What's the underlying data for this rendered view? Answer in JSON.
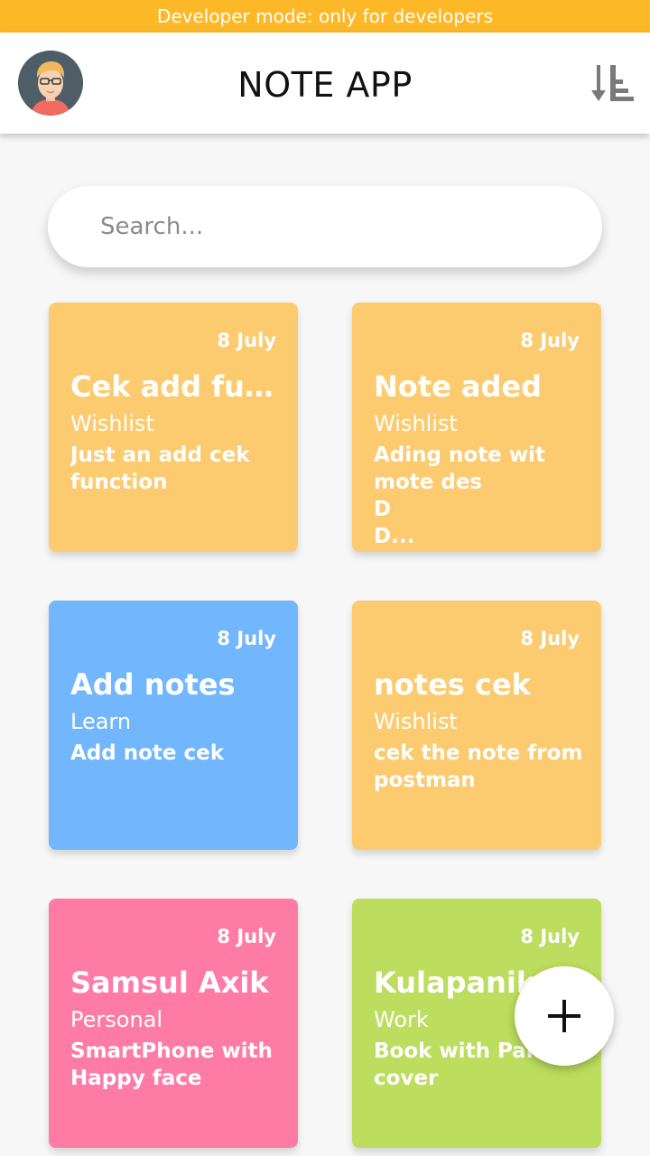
{
  "status_banner": "Developer mode: only for developers",
  "app_bar": {
    "title": "NOTE APP",
    "avatar_icon": "avatar-icon",
    "sort_icon": "sort-descending-icon"
  },
  "search": {
    "placeholder": "Search..."
  },
  "notes": [
    {
      "date": "8 July",
      "title": "Cek add fun...",
      "category": "Wishlist",
      "description": "Just an add cek\nfunction",
      "color": "#fccb70"
    },
    {
      "date": "8 July",
      "title": "Note aded",
      "category": "Wishlist",
      "description": "Ading note wit\nmote des\nD\nD...",
      "color": "#fccb70"
    },
    {
      "date": "8 July",
      "title": "Add notes",
      "category": "Learn",
      "description": "Add note cek",
      "color": "#72b6fd"
    },
    {
      "date": "8 July",
      "title": "notes cek",
      "category": "Wishlist",
      "description": "cek the note from\npostman",
      "color": "#fccb70"
    },
    {
      "date": "8 July",
      "title": "Samsul Axik",
      "category": "Personal",
      "description": "SmartPhone with\nHappy face",
      "color": "#fe7ba6"
    },
    {
      "date": "8 July",
      "title": "Kulapanik",
      "category": "Work",
      "description": "Book with Panic\ncover",
      "color": "#bcdd5d"
    }
  ],
  "fab": {
    "icon": "plus-icon"
  },
  "colors": {
    "banner": "#fcb826",
    "wishlist": "#fccb70",
    "learn": "#72b6fd",
    "personal": "#fe7ba6",
    "work": "#bcdd5d"
  }
}
